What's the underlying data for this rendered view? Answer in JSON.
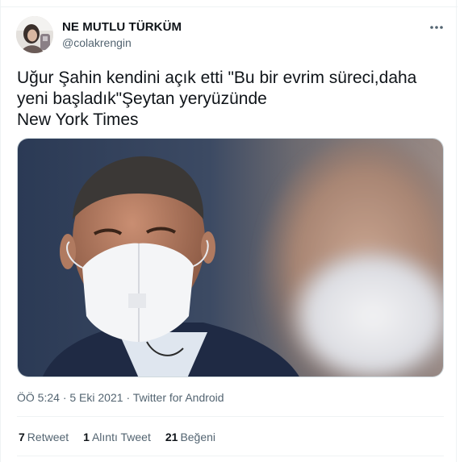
{
  "user": {
    "display_name": "NE MUTLU TÜRKÜM",
    "handle": "@colakrengin"
  },
  "menu": {
    "more_icon": "more-horizontal-icon",
    "more_glyph": "•••"
  },
  "tweet": {
    "lines": [
      "Uğur Şahin kendini açık etti \"Bu bir evrim süreci,daha",
      "yeni başladık\"Şeytan yeryüzünde",
      "New York Times"
    ]
  },
  "meta": {
    "time": "ÖÖ 5:24",
    "separator": "·",
    "date": "5 Eki 2021",
    "source": "Twitter for Android"
  },
  "stats": [
    {
      "count": "7",
      "label": "Retweet"
    },
    {
      "count": "1",
      "label": "Alıntı Tweet"
    },
    {
      "count": "21",
      "label": "Beğeni"
    }
  ],
  "colors": {
    "text_primary": "#0f1419",
    "text_secondary": "#536471",
    "border": "#eff3f4"
  }
}
